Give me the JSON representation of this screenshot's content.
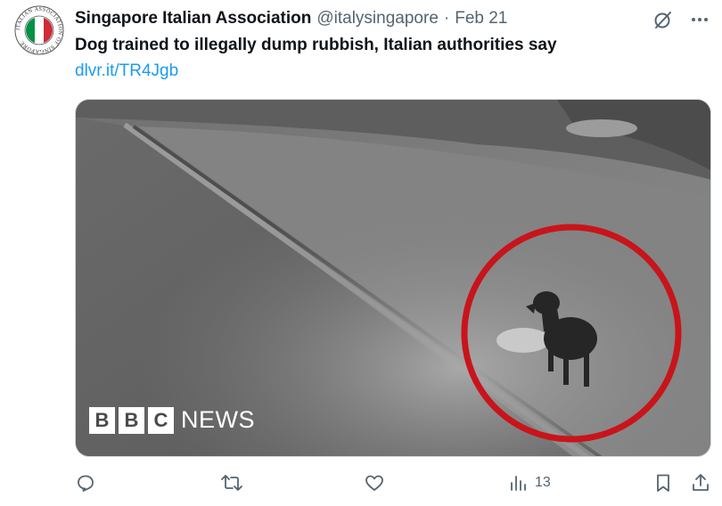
{
  "author": {
    "display_name": "Singapore Italian Association",
    "handle": "@italysingapore",
    "separator": "·",
    "date": "Feb 21",
    "avatar": {
      "ring_text": "ITALIAN ASSOCIATION OF SINGAPORE",
      "flag_colors": [
        "#009246",
        "#ffffff",
        "#ce2b37"
      ]
    }
  },
  "header_icons": [
    "grok-slash-icon",
    "more-icon"
  ],
  "tweet": {
    "text": "Dog trained to illegally dump rubbish, Italian authorities say",
    "link": "dlvr.it/TR4Jgb"
  },
  "media": {
    "description_icon": "cctv-night-photo",
    "highlight_color": "#c8141b",
    "logo": {
      "blocks": [
        "B",
        "B",
        "C"
      ],
      "word": "NEWS"
    }
  },
  "actions": {
    "reply": {
      "icon": "reply-icon",
      "count": ""
    },
    "retweet": {
      "icon": "retweet-icon",
      "count": ""
    },
    "like": {
      "icon": "heart-icon",
      "count": ""
    },
    "views": {
      "icon": "views-icon",
      "count": "13"
    },
    "bookmark": {
      "icon": "bookmark-icon"
    },
    "share": {
      "icon": "share-icon"
    }
  },
  "colors": {
    "text": "#0f1419",
    "secondary": "#536471",
    "link": "#1d9bf0"
  }
}
